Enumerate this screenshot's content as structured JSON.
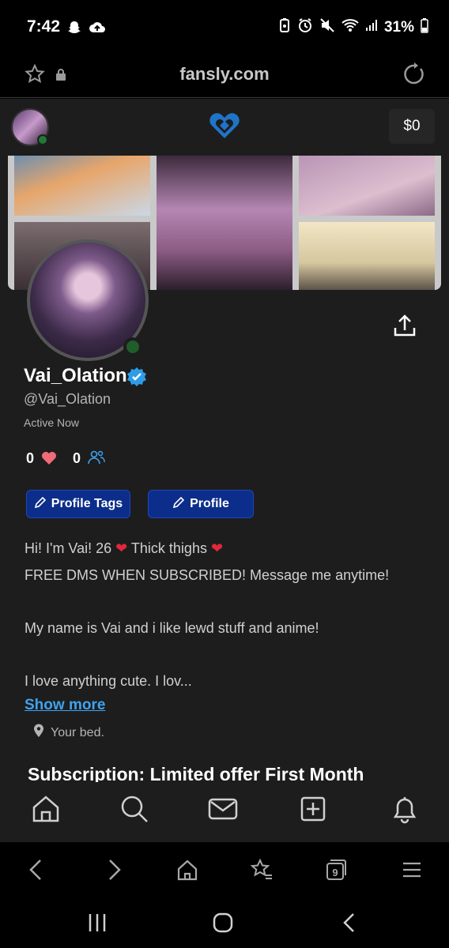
{
  "status_bar": {
    "time": "7:42",
    "battery": "31%"
  },
  "browser": {
    "url": "fansly.com",
    "tab_count": "9"
  },
  "header": {
    "balance": "$0"
  },
  "profile": {
    "display_name": "Vai_Olation",
    "username": "@Vai_Olation",
    "status": "Active Now",
    "likes": "0",
    "followers": "0",
    "buttons": {
      "tags": "Profile Tags",
      "profile": "Profile"
    },
    "bio": {
      "line1_a": "Hi! I'm Vai! 26 ",
      "line1_b": " Thick thighs ",
      "line2": "FREE DMS WHEN SUBSCRIBED! Message me anytime!",
      "line3": "",
      "line4": "My name is Vai and i like lewd stuff and anime!",
      "line5": "",
      "line6": "I love anything cute. I lov..."
    },
    "show_more": "Show more ",
    "location": "Your bed."
  },
  "subscription": {
    "heading": "Subscription: Limited offer First Month"
  },
  "colors": {
    "accent_blue": "#0c2d8a",
    "link_blue": "#3ea3f0",
    "online_green": "#1f7a32",
    "heart_red": "#e0283a"
  },
  "icons": {
    "nav": [
      "home-icon",
      "search-icon",
      "mail-icon",
      "plus-square-icon",
      "bell-icon"
    ],
    "toolbar": [
      "back-icon",
      "forward-icon",
      "home-icon",
      "bookmarks-icon",
      "tabs-icon",
      "menu-icon"
    ],
    "system": [
      "recents-icon",
      "home-icon",
      "back-icon"
    ]
  }
}
